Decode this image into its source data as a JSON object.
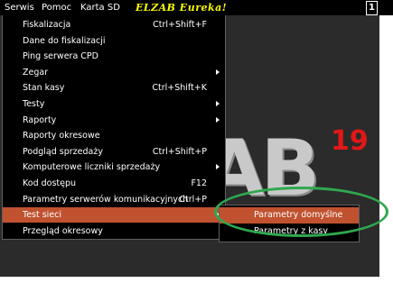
{
  "menubar": {
    "items": [
      "Serwis",
      "Pomoc",
      "Karta SD"
    ],
    "app_title": "ELZAB  Eureka!",
    "corner_badge": "1"
  },
  "logo": {
    "letters": "AB",
    "year_text": "19"
  },
  "main_menu": {
    "items": [
      {
        "label": "Fiskalizacja",
        "shortcut": "Ctrl+Shift+F",
        "submenu": false
      },
      {
        "label": "Dane do fiskalizacji",
        "shortcut": "",
        "submenu": false
      },
      {
        "label": "Ping serwera CPD",
        "shortcut": "",
        "submenu": false
      },
      {
        "label": "Zegar",
        "shortcut": "",
        "submenu": true
      },
      {
        "label": "Stan kasy",
        "shortcut": "Ctrl+Shift+K",
        "submenu": false
      },
      {
        "label": "Testy",
        "shortcut": "",
        "submenu": true
      },
      {
        "label": "Raporty",
        "shortcut": "",
        "submenu": true
      },
      {
        "label": "Raporty okresowe",
        "shortcut": "",
        "submenu": false
      },
      {
        "label": "Podgląd sprzedaży",
        "shortcut": "Ctrl+Shift+P",
        "submenu": false
      },
      {
        "label": "Komputerowe liczniki sprzedaży",
        "shortcut": "",
        "submenu": true
      },
      {
        "label": "Kod dostępu",
        "shortcut": "F12",
        "submenu": false
      },
      {
        "label": "Parametry serwerów komunikacyjnych",
        "shortcut": "Ctrl+P",
        "submenu": false
      },
      {
        "label": "Test sieci",
        "shortcut": "",
        "submenu": true,
        "active": true
      },
      {
        "label": "Przegląd okresowy",
        "shortcut": "",
        "submenu": false
      }
    ]
  },
  "sub_menu": {
    "items": [
      {
        "label": "Parametry domyślne",
        "active": true
      },
      {
        "label": "Parametry z kasy",
        "active": false
      }
    ]
  },
  "colors": {
    "menu_background": "#000000",
    "highlight": "#c0522f",
    "app_title": "#ffff00",
    "annotation": "#2fa84f",
    "logo_year": "#e01818"
  }
}
